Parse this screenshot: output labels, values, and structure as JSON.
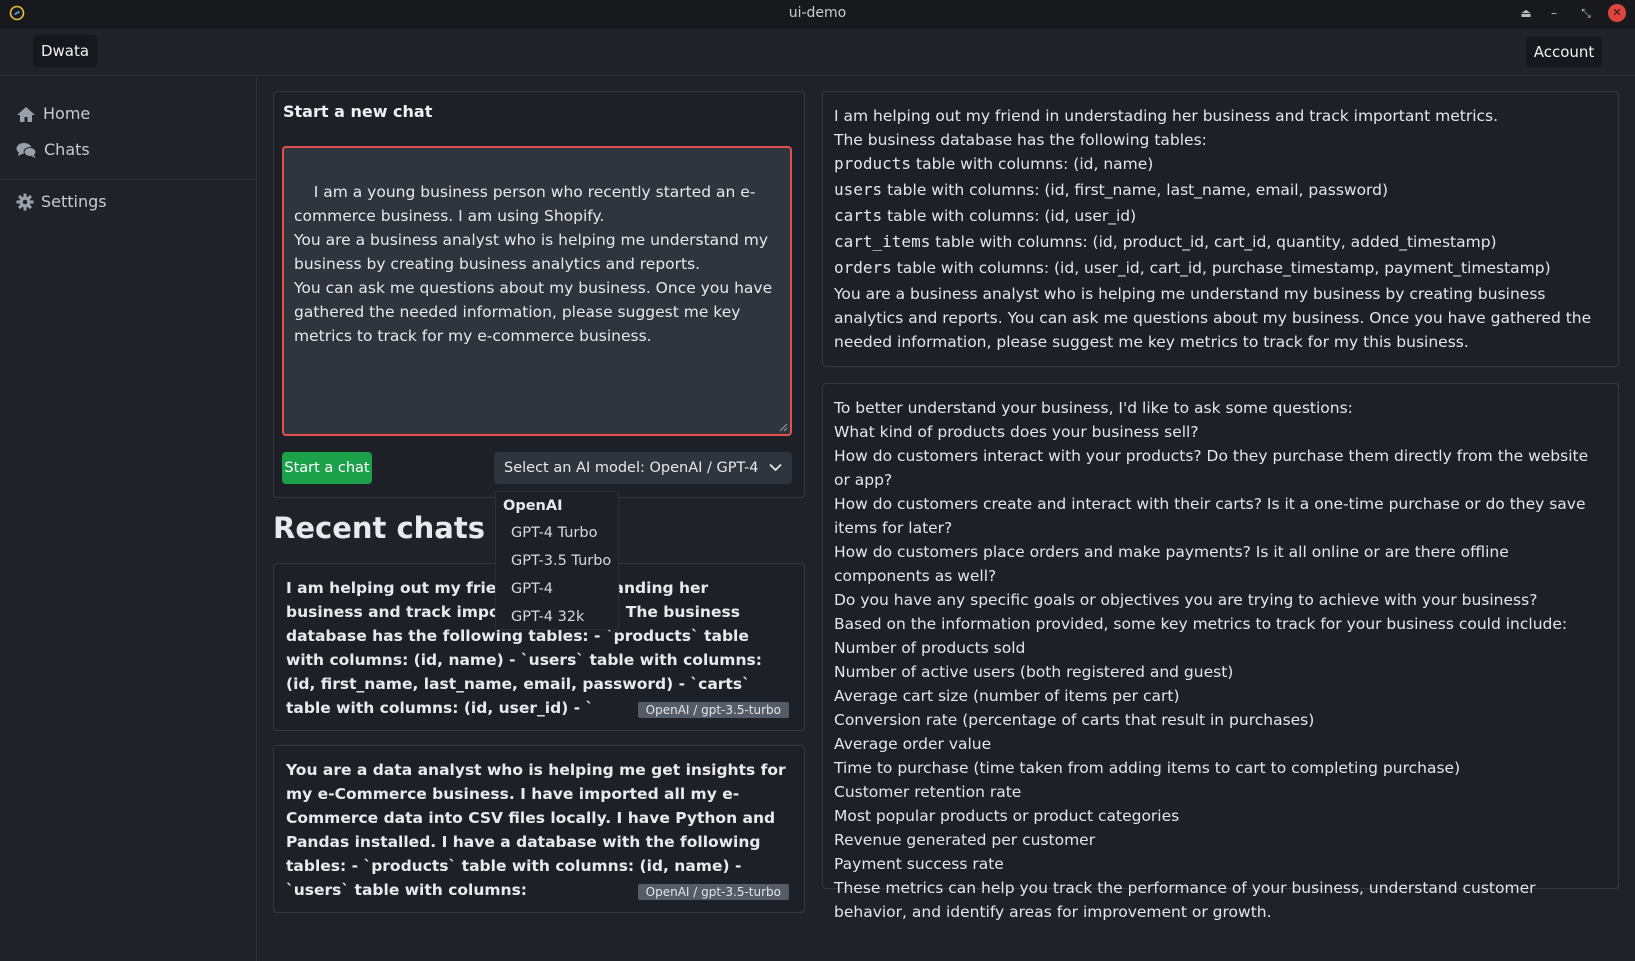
{
  "window": {
    "title": "ui-demo",
    "controls": [
      "eject-icon",
      "minimize-icon",
      "restore-icon",
      "close-icon"
    ]
  },
  "topnav": {
    "brand": "Dwata",
    "account_label": "Account"
  },
  "sidebar": {
    "items": [
      {
        "label": "Home",
        "icon": "home-icon"
      },
      {
        "label": "Chats",
        "icon": "chats-icon"
      },
      {
        "label": "Settings",
        "icon": "gear-icon"
      }
    ]
  },
  "new_chat": {
    "title": "Start a new chat",
    "prompt_value": "I am a young business person who recently started an e-commerce business. I am using Shopify.\nYou are a business analyst who is helping me understand my business by creating business analytics and reports.\nYou can ask me questions about my business. Once you have gathered the needed information, please suggest me key metrics to track for my e-commerce business.",
    "start_button": "Start a chat",
    "model_select_label": "Select an AI model: OpenAI / GPT-4 Turbo",
    "dropdown": {
      "group": "OpenAI",
      "options": [
        "GPT-4 Turbo",
        "GPT-3.5 Turbo",
        "GPT-4",
        "GPT-4 32k"
      ]
    }
  },
  "recent": {
    "heading": "Recent chats wit",
    "chats": [
      {
        "text": "I am helping out my friend in understanding her business and track important metrics. The business database has the following tables: - `products` table with columns: (id, name) - `users` table with columns: (id, first_name, last_name, email, password) - `carts` table with columns: (id, user_id) - `",
        "model": "OpenAI / gpt-3.5-turbo"
      },
      {
        "text": "You are a data analyst who is helping me get insights for my e-Commerce business. I have imported all my e-Commerce data into CSV files locally. I have Python and Pandas installed. I have a database with the following tables: - `products` table with columns: (id, name) - `users` table with columns:",
        "model": "OpenAI / gpt-3.5-turbo"
      }
    ]
  },
  "user_message": {
    "intro1": "I am helping out my friend in understading her business and track important metrics.",
    "intro2": "The business database has the following tables:",
    "tables": [
      {
        "name": "products",
        "desc": "table with columns: (id, name)"
      },
      {
        "name": "users",
        "desc": "table with columns: (id, first_name, last_name, email, password)"
      },
      {
        "name": "carts",
        "desc": "table with columns: (id, user_id)"
      },
      {
        "name": "cart_items",
        "desc": "table with columns: (id, product_id, cart_id, quantity, added_timestamp)"
      },
      {
        "name": "orders",
        "desc": "table with columns: (id, user_id, cart_id, purchase_timestamp, payment_timestamp)"
      }
    ],
    "closing": "You are a business analyst who is helping me understand my business by creating business analytics and reports. You can ask me questions about my business. Once you have gathered the needed information, please suggest me key metrics to track for my this business."
  },
  "assistant_message": {
    "lines": [
      "To better understand your business, I'd like to ask some questions:",
      "What kind of products does your business sell?",
      "How do customers interact with your products? Do they purchase them directly from the website or app?",
      "How do customers create and interact with their carts? Is it a one-time purchase or do they save items for later?",
      "How do customers place orders and make payments? Is it all online or are there offline components as well?",
      "Do you have any specific goals or objectives you are trying to achieve with your business?",
      "Based on the information provided, some key metrics to track for your business could include:",
      "Number of products sold",
      "Number of active users (both registered and guest)",
      "Average cart size (number of items per cart)",
      "Conversion rate (percentage of carts that result in purchases)",
      "Average order value",
      "Time to purchase (time taken from adding items to cart to completing purchase)",
      "Customer retention rate",
      "Most popular products or product categories",
      "Revenue generated per customer",
      "Payment success rate",
      "These metrics can help you track the performance of your business, understand customer behavior, and identify areas for improvement or growth."
    ]
  },
  "colors": {
    "background": "#1f2329",
    "accent_green": "#1ba14a",
    "error_red": "#e2504b",
    "badge": "#565c66"
  }
}
